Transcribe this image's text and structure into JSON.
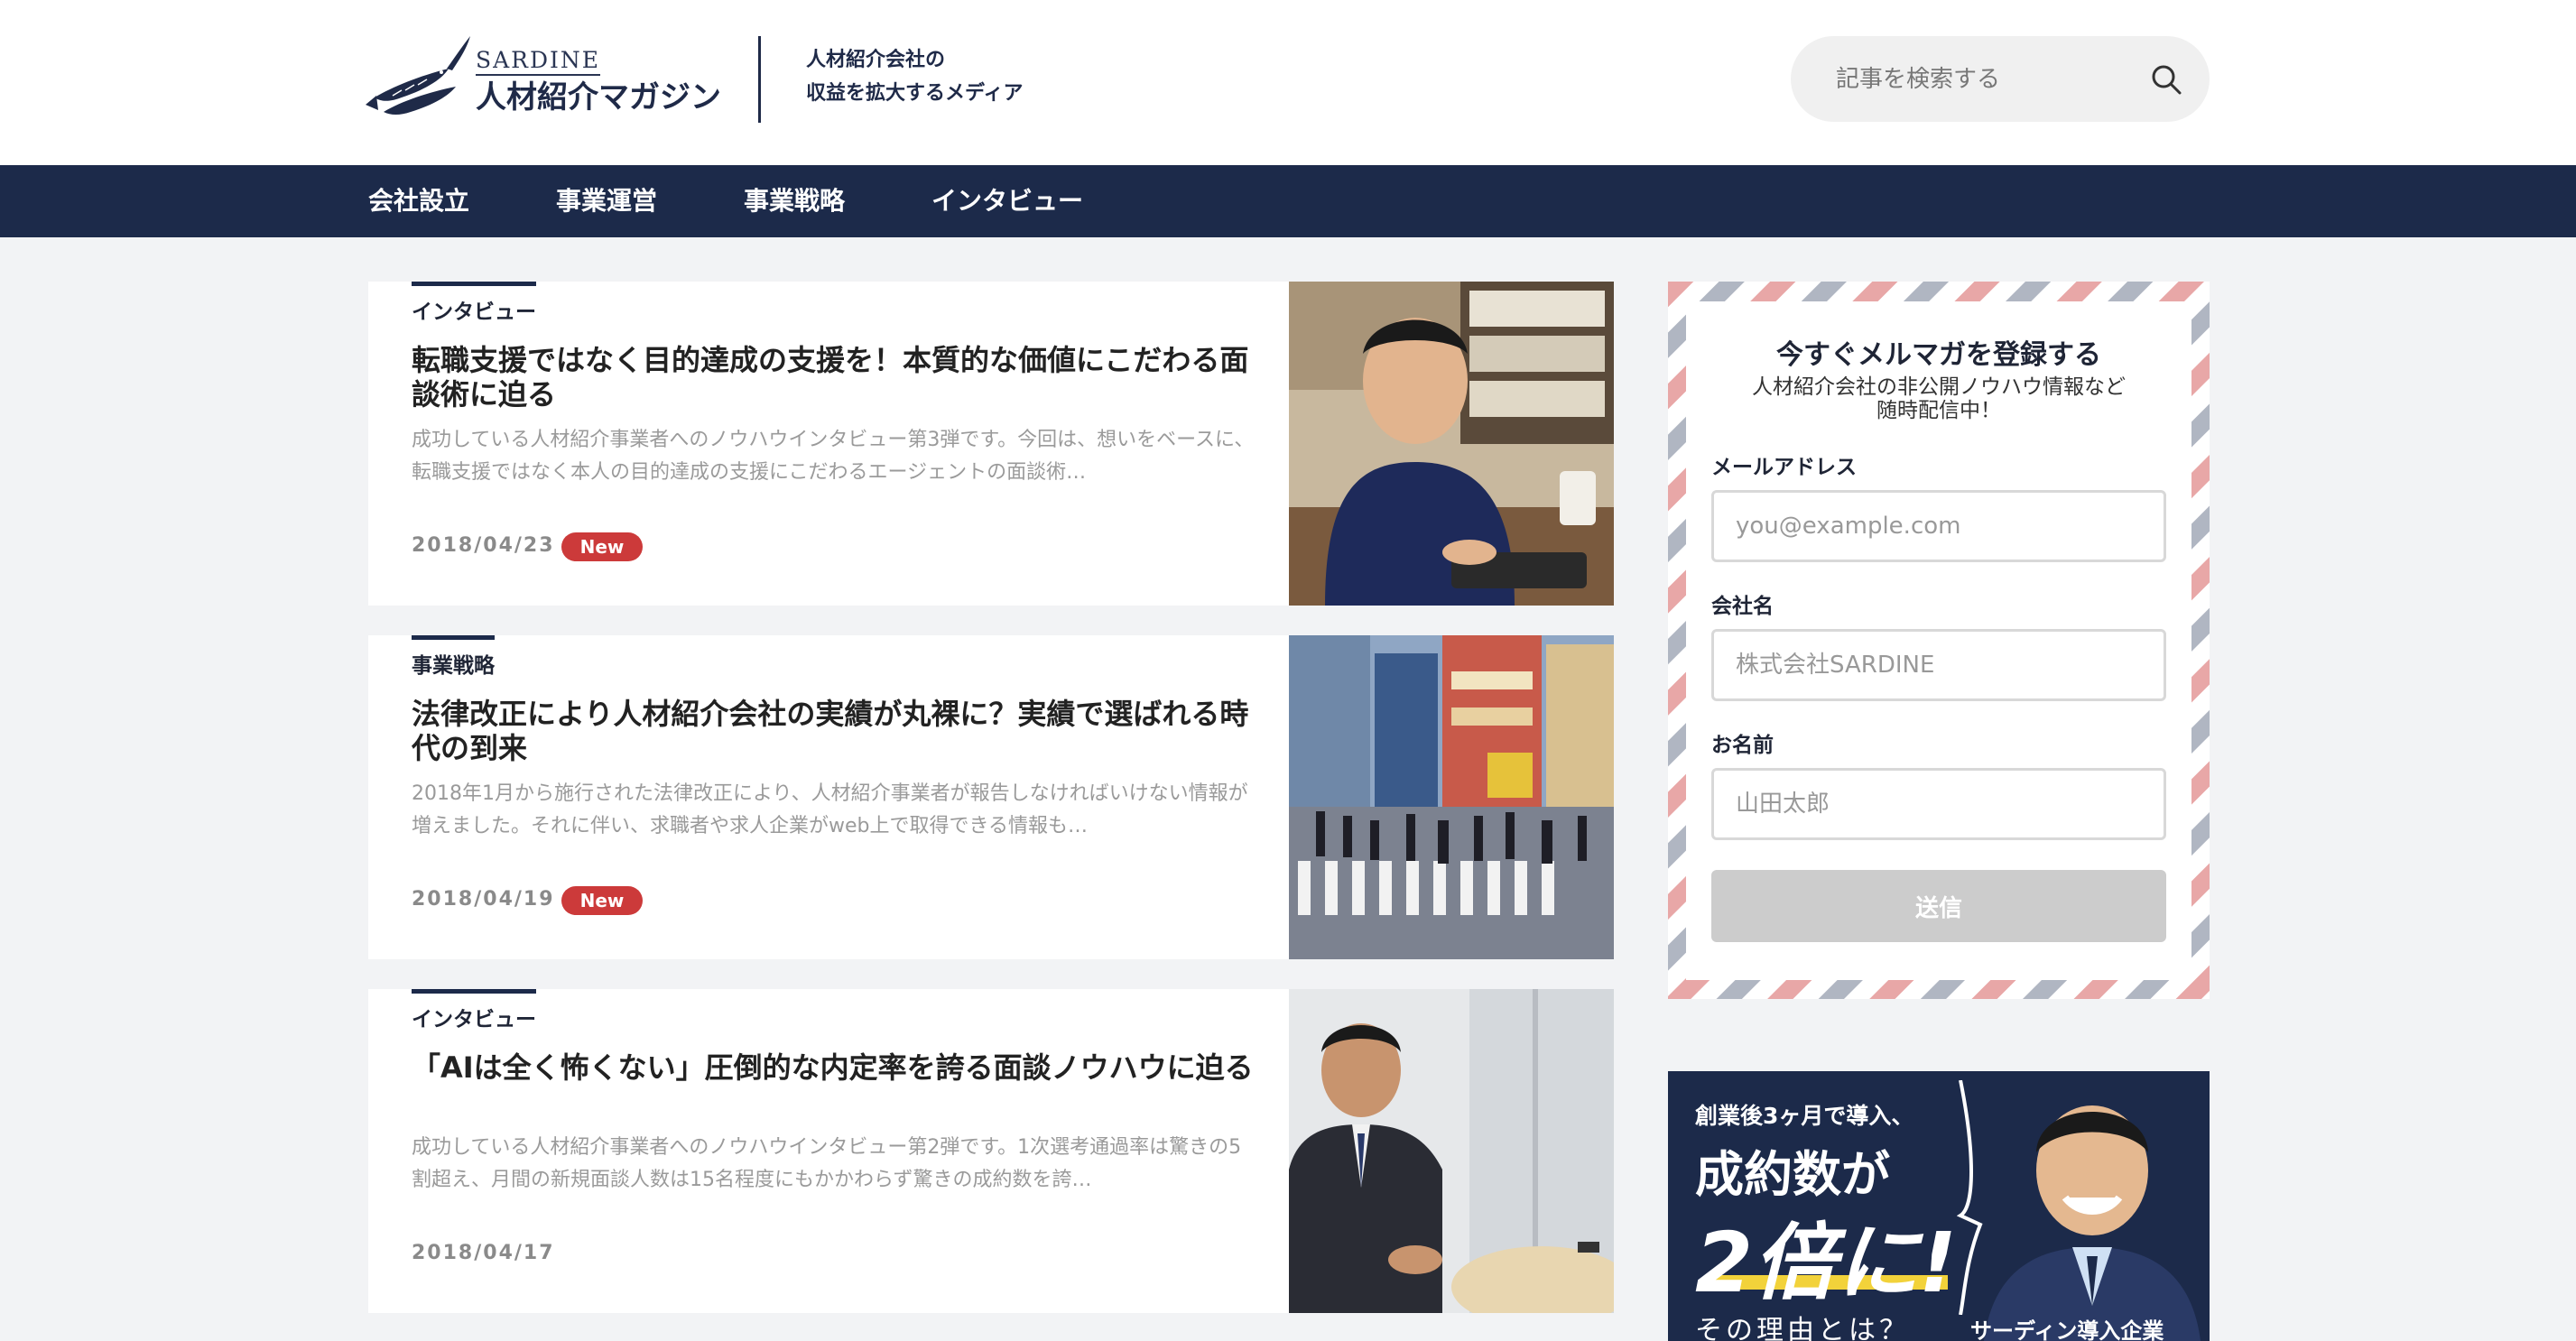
{
  "header": {
    "logo_en": "SARDINE",
    "logo_name": "人材紹介マガジン",
    "tagline_1": "人材紹介会社の",
    "tagline_2": "収益を拡大するメディア",
    "search_placeholder": "記事を検索する"
  },
  "nav": {
    "items": [
      {
        "label": "会社設立"
      },
      {
        "label": "事業運営"
      },
      {
        "label": "事業戦略"
      },
      {
        "label": "インタビュー"
      }
    ]
  },
  "articles": [
    {
      "category": "インタビュー",
      "title": "転職支援ではなく目的達成の支援を！本質的な価値にこだわる面談術に迫る",
      "excerpt": "成功している人材紹介事業者へのノウハウインタビュー第3弾です。今回は、想いをベースに、転職支援ではなく本人の目的達成の支援にこだわるエージェントの面談術…",
      "date": "2018/04/23",
      "badge": "New"
    },
    {
      "category": "事業戦略",
      "title": "法律改正により人材紹介会社の実績が丸裸に？実績で選ばれる時代の到来",
      "excerpt": "2018年1月から施行された法律改正により、人材紹介事業者が報告しなければいけない情報が増えました。それに伴い、求職者や求人企業がweb上で取得できる情報も…",
      "date": "2018/04/19",
      "badge": "New"
    },
    {
      "category": "インタビュー",
      "title": "「AIは全く怖くない」圧倒的な内定率を誇る面談ノウハウに迫る",
      "excerpt": "成功している人材紹介事業者へのノウハウインタビュー第2弾です。1次選考通過率は驚きの5割超え、月間の新規面談人数は15名程度にもかかわらず驚きの成約数を誇…",
      "date": "2018/04/17",
      "badge": ""
    }
  ],
  "newsletter": {
    "title": "今すぐメルマガを登録する",
    "sub_1": "人材紹介会社の非公開ノウハウ情報など",
    "sub_2": "随時配信中！",
    "email_label": "メールアドレス",
    "email_placeholder": "you@example.com",
    "company_label": "会社名",
    "company_placeholder": "株式会社SARDINE",
    "name_label": "お名前",
    "name_placeholder": "山田太郎",
    "submit_label": "送信"
  },
  "banner": {
    "line1": "創業後3ヶ月で導入、",
    "line2": "成約数が",
    "line3": "2倍に!",
    "line4": "その理由とは？",
    "line5": "サーディン導入企業"
  },
  "colors": {
    "navy": "#1c2a4a",
    "badge_red": "#cc3a3a",
    "airmail_red": "#e8a7a7",
    "airmail_gray": "#b0b6c2",
    "highlight_yellow": "#f2d23a"
  }
}
